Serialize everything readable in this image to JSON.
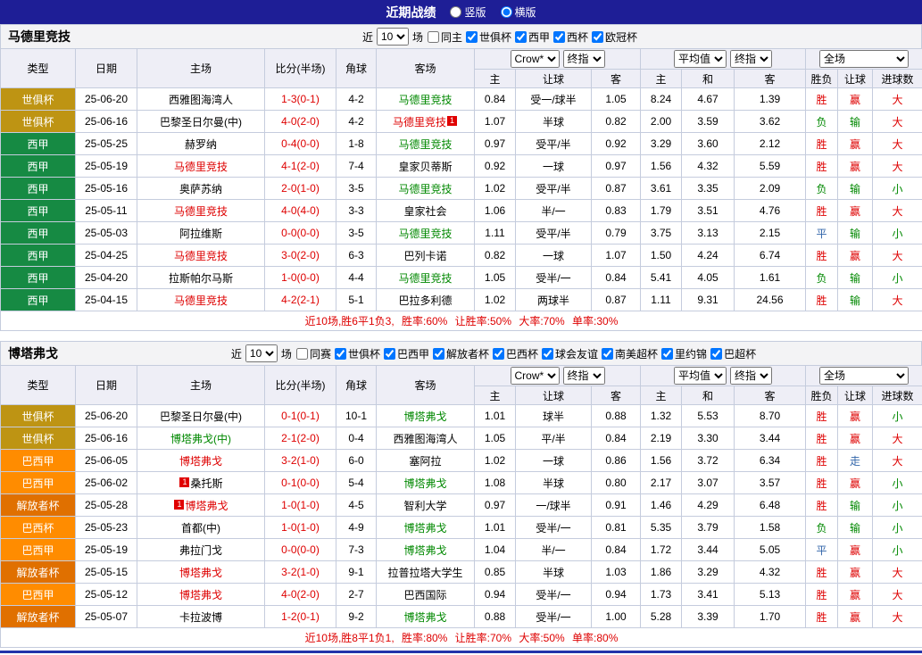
{
  "topbar": {
    "title": "近期战绩",
    "vertical_label": "竖版",
    "horizontal_label": "横版",
    "layout_selected": "横版"
  },
  "filter_labels": {
    "near": "近",
    "games": "场"
  },
  "table_header": {
    "type": "类型",
    "date": "日期",
    "home": "主场",
    "score": "比分(半场)",
    "corner": "角球",
    "away": "客场",
    "asia_select_1": "Crow*",
    "asia_select_2": "终指",
    "euro_select_1": "平均值",
    "euro_select_2": "终指",
    "scope_select": "全场",
    "asia_home": "主",
    "asia_handicap": "让球",
    "asia_away": "客",
    "euro_home": "主",
    "euro_draw": "和",
    "euro_away": "客",
    "res_wdl": "胜负",
    "res_handicap": "让球",
    "res_goals": "进球数"
  },
  "colors": {
    "topbar_bg": "#1E1E96",
    "header_bg": "#EEEEF6",
    "border": "#C5CCDD",
    "red": "#DE0000",
    "green": "#008800",
    "blue": "#3366AA",
    "black": "#000000",
    "type_colors": {
      "世俱杯": "#BE9413",
      "西甲": "#168A43",
      "巴西甲": "#FF8C00",
      "解放者杯": "#E07000",
      "巴西杯": "#FF8C00"
    }
  },
  "result_colors": {
    "胜": "red",
    "平": "blue",
    "负": "green",
    "赢": "red",
    "走": "blue",
    "输": "green",
    "大": "red",
    "小": "green"
  },
  "sections": [
    {
      "team": "马德里竞技",
      "count": "10",
      "same_label": "同主",
      "same_checked": false,
      "competitions": [
        "世俱杯",
        "西甲",
        "西杯",
        "欧冠杯"
      ],
      "rows": [
        {
          "comp": "世俱杯",
          "date": "25-06-20",
          "home": "西雅图海湾人",
          "hc": "",
          "score": "1-3(0-1)",
          "corner": "4-2",
          "away": "马德里竞技",
          "ac": "green",
          "ah": "0.84",
          "hcap": "受一/球半",
          "aa": "1.05",
          "eh": "8.24",
          "ed": "4.67",
          "ea": "1.39",
          "wdl": "胜",
          "hres": "赢",
          "ou": "大"
        },
        {
          "comp": "世俱杯",
          "date": "25-06-16",
          "home": "巴黎圣日尔曼(中)",
          "hc": "",
          "score": "4-0(2-0)",
          "corner": "4-2",
          "away": "马德里竞技",
          "ac": "red",
          "ab_post": "1",
          "ah": "1.07",
          "hcap": "半球",
          "aa": "0.82",
          "eh": "2.00",
          "ed": "3.59",
          "ea": "3.62",
          "wdl": "负",
          "hres": "输",
          "ou": "大"
        },
        {
          "comp": "西甲",
          "date": "25-05-25",
          "home": "赫罗纳",
          "hc": "",
          "score": "0-4(0-0)",
          "corner": "1-8",
          "away": "马德里竞技",
          "ac": "green",
          "ah": "0.97",
          "hcap": "受平/半",
          "aa": "0.92",
          "eh": "3.29",
          "ed": "3.60",
          "ea": "2.12",
          "wdl": "胜",
          "hres": "赢",
          "ou": "大"
        },
        {
          "comp": "西甲",
          "date": "25-05-19",
          "home": "马德里竞技",
          "hc": "red",
          "score": "4-1(2-0)",
          "corner": "7-4",
          "away": "皇家贝蒂斯",
          "ac": "",
          "ah": "0.92",
          "hcap": "一球",
          "aa": "0.97",
          "eh": "1.56",
          "ed": "4.32",
          "ea": "5.59",
          "wdl": "胜",
          "hres": "赢",
          "ou": "大"
        },
        {
          "comp": "西甲",
          "date": "25-05-16",
          "home": "奥萨苏纳",
          "hc": "",
          "score": "2-0(1-0)",
          "corner": "3-5",
          "away": "马德里竞技",
          "ac": "green",
          "ah": "1.02",
          "hcap": "受平/半",
          "aa": "0.87",
          "eh": "3.61",
          "ed": "3.35",
          "ea": "2.09",
          "wdl": "负",
          "hres": "输",
          "ou": "小"
        },
        {
          "comp": "西甲",
          "date": "25-05-11",
          "home": "马德里竞技",
          "hc": "red",
          "score": "4-0(4-0)",
          "corner": "3-3",
          "away": "皇家社会",
          "ac": "",
          "ah": "1.06",
          "hcap": "半/一",
          "aa": "0.83",
          "eh": "1.79",
          "ed": "3.51",
          "ea": "4.76",
          "wdl": "胜",
          "hres": "赢",
          "ou": "大"
        },
        {
          "comp": "西甲",
          "date": "25-05-03",
          "home": "阿拉维斯",
          "hc": "",
          "score": "0-0(0-0)",
          "corner": "3-5",
          "away": "马德里竞技",
          "ac": "green",
          "ah": "1.11",
          "hcap": "受平/半",
          "aa": "0.79",
          "eh": "3.75",
          "ed": "3.13",
          "ea": "2.15",
          "wdl": "平",
          "hres": "输",
          "ou": "小"
        },
        {
          "comp": "西甲",
          "date": "25-04-25",
          "home": "马德里竞技",
          "hc": "red",
          "score": "3-0(2-0)",
          "corner": "6-3",
          "away": "巴列卡诺",
          "ac": "",
          "ah": "0.82",
          "hcap": "一球",
          "aa": "1.07",
          "eh": "1.50",
          "ed": "4.24",
          "ea": "6.74",
          "wdl": "胜",
          "hres": "赢",
          "ou": "大"
        },
        {
          "comp": "西甲",
          "date": "25-04-20",
          "home": "拉斯帕尔马斯",
          "hc": "",
          "score": "1-0(0-0)",
          "corner": "4-4",
          "away": "马德里竞技",
          "ac": "green",
          "ah": "1.05",
          "hcap": "受半/一",
          "aa": "0.84",
          "eh": "5.41",
          "ed": "4.05",
          "ea": "1.61",
          "wdl": "负",
          "hres": "输",
          "ou": "小"
        },
        {
          "comp": "西甲",
          "date": "25-04-15",
          "home": "马德里竞技",
          "hc": "red",
          "score": "4-2(2-1)",
          "corner": "5-1",
          "away": "巴拉多利德",
          "ac": "",
          "ah": "1.02",
          "hcap": "两球半",
          "aa": "0.87",
          "eh": "1.11",
          "ed": "9.31",
          "ea": "24.56",
          "wdl": "胜",
          "hres": "输",
          "ou": "大"
        }
      ],
      "summary": "近10场,胜6平1负3, 胜率:60% 让胜率:50% 大率:70% 单率:30%"
    },
    {
      "team": "博塔弗戈",
      "count": "10",
      "same_label": "同赛",
      "same_checked": false,
      "competitions": [
        "世俱杯",
        "巴西甲",
        "解放者杯",
        "巴西杯",
        "球会友谊",
        "南美超杯",
        "里约锦",
        "巴超杯"
      ],
      "rows": [
        {
          "comp": "世俱杯",
          "date": "25-06-20",
          "home": "巴黎圣日尔曼(中)",
          "hc": "",
          "score": "0-1(0-1)",
          "corner": "10-1",
          "away": "博塔弗戈",
          "ac": "green",
          "ah": "1.01",
          "hcap": "球半",
          "aa": "0.88",
          "eh": "1.32",
          "ed": "5.53",
          "ea": "8.70",
          "wdl": "胜",
          "hres": "赢",
          "ou": "小"
        },
        {
          "comp": "世俱杯",
          "date": "25-06-16",
          "home": "博塔弗戈(中)",
          "hc": "green",
          "score": "2-1(2-0)",
          "corner": "0-4",
          "away": "西雅图海湾人",
          "ac": "",
          "ah": "1.05",
          "hcap": "平/半",
          "aa": "0.84",
          "eh": "2.19",
          "ed": "3.30",
          "ea": "3.44",
          "wdl": "胜",
          "hres": "赢",
          "ou": "大"
        },
        {
          "comp": "巴西甲",
          "date": "25-06-05",
          "home": "博塔弗戈",
          "hc": "red",
          "score": "3-2(1-0)",
          "corner": "6-0",
          "away": "塞阿拉",
          "ac": "",
          "ah": "1.02",
          "hcap": "一球",
          "aa": "0.86",
          "eh": "1.56",
          "ed": "3.72",
          "ea": "6.34",
          "wdl": "胜",
          "hres": "走",
          "ou": "大"
        },
        {
          "comp": "巴西甲",
          "date": "25-06-02",
          "home": "桑托斯",
          "hc": "",
          "hb_pre": "1",
          "score": "0-1(0-0)",
          "corner": "5-4",
          "away": "博塔弗戈",
          "ac": "green",
          "ah": "1.08",
          "hcap": "半球",
          "aa": "0.80",
          "eh": "2.17",
          "ed": "3.07",
          "ea": "3.57",
          "wdl": "胜",
          "hres": "赢",
          "ou": "小"
        },
        {
          "comp": "解放者杯",
          "date": "25-05-28",
          "home": "博塔弗戈",
          "hc": "red",
          "hb_pre": "1",
          "score": "1-0(1-0)",
          "corner": "4-5",
          "away": "智利大学",
          "ac": "",
          "ah": "0.97",
          "hcap": "一/球半",
          "aa": "0.91",
          "eh": "1.46",
          "ed": "4.29",
          "ea": "6.48",
          "wdl": "胜",
          "hres": "输",
          "ou": "小"
        },
        {
          "comp": "巴西杯",
          "date": "25-05-23",
          "home": "首都(中)",
          "hc": "",
          "score": "1-0(1-0)",
          "corner": "4-9",
          "away": "博塔弗戈",
          "ac": "green",
          "ah": "1.01",
          "hcap": "受半/一",
          "aa": "0.81",
          "eh": "5.35",
          "ed": "3.79",
          "ea": "1.58",
          "wdl": "负",
          "hres": "输",
          "ou": "小"
        },
        {
          "comp": "巴西甲",
          "date": "25-05-19",
          "home": "弗拉门戈",
          "hc": "",
          "score": "0-0(0-0)",
          "corner": "7-3",
          "away": "博塔弗戈",
          "ac": "green",
          "ah": "1.04",
          "hcap": "半/一",
          "aa": "0.84",
          "eh": "1.72",
          "ed": "3.44",
          "ea": "5.05",
          "wdl": "平",
          "hres": "赢",
          "ou": "小"
        },
        {
          "comp": "解放者杯",
          "date": "25-05-15",
          "home": "博塔弗戈",
          "hc": "red",
          "score": "3-2(1-0)",
          "corner": "9-1",
          "away": "拉普拉塔大学生",
          "ac": "",
          "ah": "0.85",
          "hcap": "半球",
          "aa": "1.03",
          "eh": "1.86",
          "ed": "3.29",
          "ea": "4.32",
          "wdl": "胜",
          "hres": "赢",
          "ou": "大"
        },
        {
          "comp": "巴西甲",
          "date": "25-05-12",
          "home": "博塔弗戈",
          "hc": "red",
          "score": "4-0(2-0)",
          "corner": "2-7",
          "away": "巴西国际",
          "ac": "",
          "ah": "0.94",
          "hcap": "受半/一",
          "aa": "0.94",
          "eh": "1.73",
          "ed": "3.41",
          "ea": "5.13",
          "wdl": "胜",
          "hres": "赢",
          "ou": "大"
        },
        {
          "comp": "解放者杯",
          "date": "25-05-07",
          "home": "卡拉波博",
          "hc": "",
          "score": "1-2(0-1)",
          "corner": "9-2",
          "away": "博塔弗戈",
          "ac": "green",
          "ah": "0.88",
          "hcap": "受半/一",
          "aa": "1.00",
          "eh": "5.28",
          "ed": "3.39",
          "ea": "1.70",
          "wdl": "胜",
          "hres": "赢",
          "ou": "大"
        }
      ],
      "summary": "近10场,胜8平1负1, 胜率:80% 让胜率:70% 大率:50% 单率:80%"
    }
  ]
}
